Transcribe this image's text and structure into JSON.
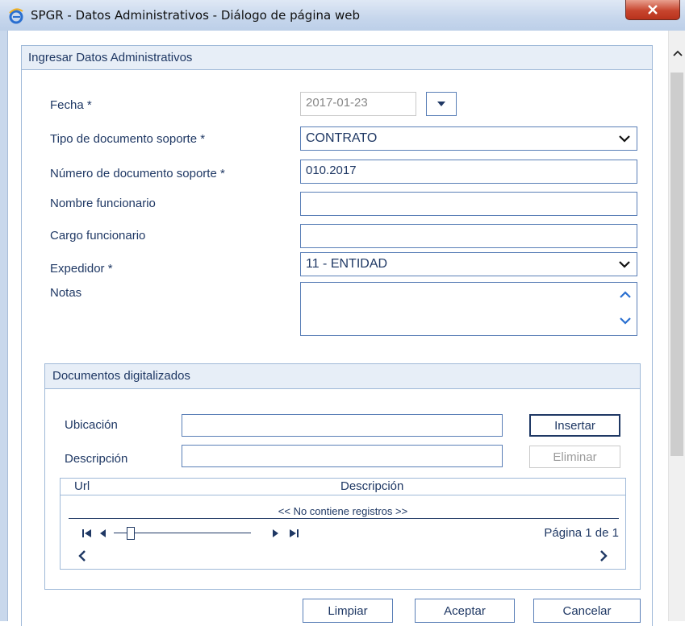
{
  "window": {
    "title": "SPGR - Datos Administrativos - Diálogo de página web"
  },
  "panel": {
    "title": "Ingresar Datos Administrativos"
  },
  "form": {
    "fecha_label": "Fecha *",
    "fecha_value": "2017-01-23",
    "tipo_label": "Tipo de documento soporte *",
    "tipo_value": "CONTRATO",
    "numero_label": "Número de documento soporte *",
    "numero_value": "010.2017",
    "nombre_label": "Nombre funcionario",
    "nombre_value": "",
    "cargo_label": "Cargo funcionario",
    "cargo_value": "",
    "expedidor_label": "Expedidor *",
    "expedidor_value": "11 - ENTIDAD",
    "notas_label": "Notas",
    "notas_value": ""
  },
  "documentos": {
    "title": "Documentos digitalizados",
    "ubicacion_label": "Ubicación",
    "descripcion_label": "Descripción",
    "insertar_label": "Insertar",
    "eliminar_label": "Eliminar",
    "grid": {
      "columns": [
        "Url",
        "Descripción"
      ],
      "empty_text": "<< No contiene registros >>",
      "page_info": "Página 1 de 1"
    }
  },
  "footer": {
    "limpiar_label": "Limpiar",
    "aceptar_label": "Aceptar",
    "cancelar_label": "Cancelar"
  },
  "colors": {
    "text": "#1f3864",
    "border": "#5a7fb7",
    "header_bg": "#e7eef7"
  }
}
